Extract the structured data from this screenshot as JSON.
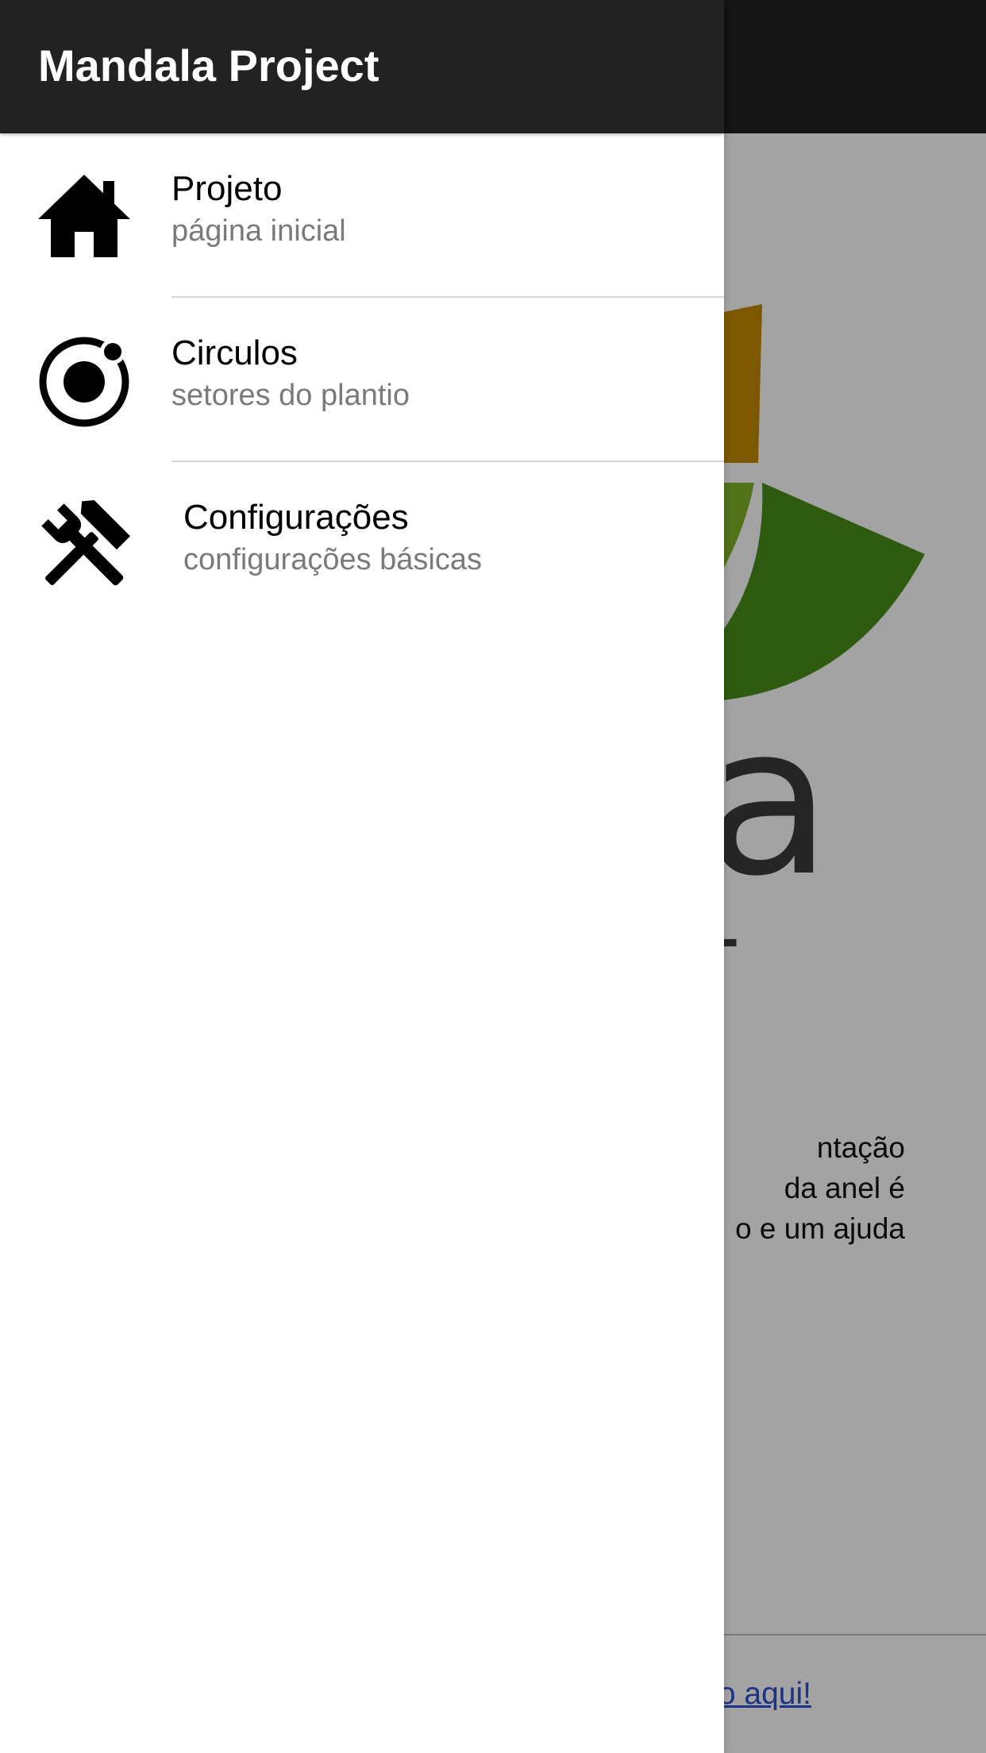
{
  "app": {
    "logo_word": "lla",
    "logo_sub": "T",
    "description": "ntação\nda anel é\no e um ajuda",
    "footer_link": "o aqui!"
  },
  "menu": {
    "title": "Mandala Project",
    "items": [
      {
        "label": "Projeto",
        "sublabel": "página inicial",
        "icon": "home-icon"
      },
      {
        "label": "Circulos",
        "sublabel": "setores do plantio",
        "icon": "ionic-icon"
      },
      {
        "label": "Configurações",
        "sublabel": "configurações básicas",
        "icon": "tools-icon"
      }
    ]
  },
  "colors": {
    "toolbar": "#222222",
    "logo_orange": "#c48a00",
    "logo_green": "#5a9a1a",
    "logo_dark_green": "#3e8a15",
    "link": "#2b4fd3"
  }
}
